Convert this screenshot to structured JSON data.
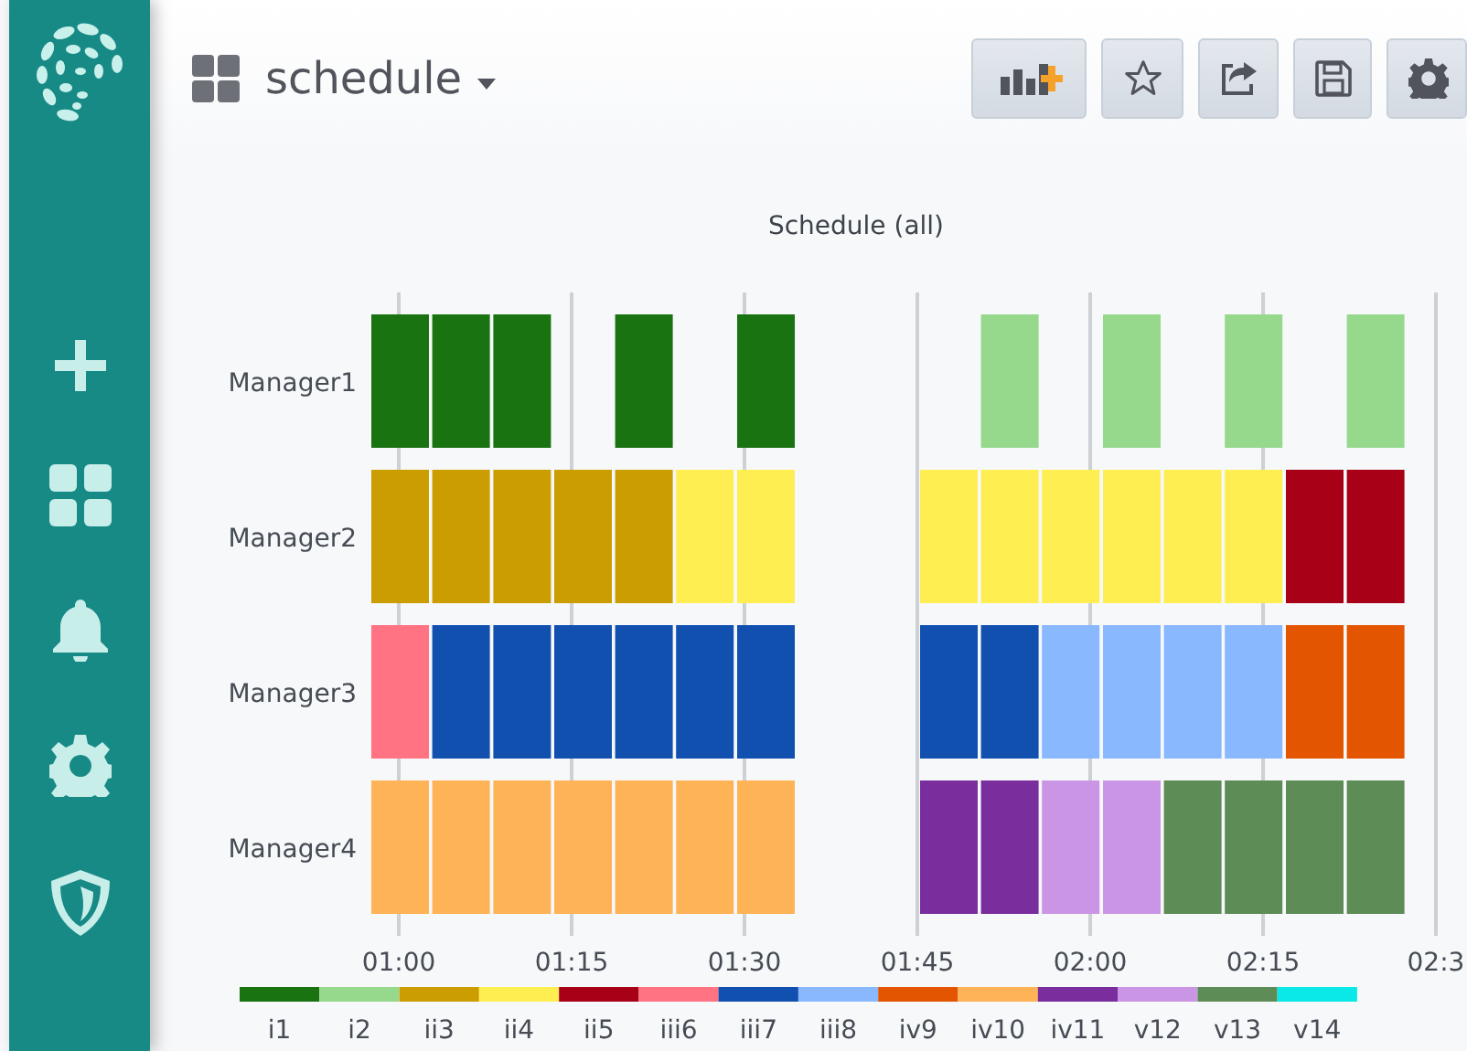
{
  "dashboard": {
    "title": "schedule"
  },
  "panel": {
    "title": "Schedule (all)",
    "x_ticks": [
      "01:00",
      "01:15",
      "01:30",
      "01:45",
      "02:00",
      "02:15",
      "02:3"
    ],
    "rows": [
      {
        "name": "Manager1",
        "cells": [
          {
            "kind": "state",
            "color": "#1a7311"
          },
          {
            "kind": "state",
            "color": "#1a7311"
          },
          {
            "kind": "state",
            "color": "#1a7311"
          },
          {
            "kind": "gap"
          },
          {
            "kind": "state",
            "color": "#1a7311"
          },
          {
            "kind": "gap"
          },
          {
            "kind": "state",
            "color": "#1a7311"
          },
          {
            "kind": "gap"
          },
          {
            "kind": "gap"
          },
          {
            "kind": "gap"
          },
          {
            "kind": "state",
            "color": "#96d98d"
          },
          {
            "kind": "gap"
          },
          {
            "kind": "state",
            "color": "#96d98d"
          },
          {
            "kind": "gap"
          },
          {
            "kind": "state",
            "color": "#96d98d"
          },
          {
            "kind": "gap"
          },
          {
            "kind": "state",
            "color": "#96d98d"
          }
        ]
      },
      {
        "name": "Manager2",
        "cells": [
          {
            "kind": "state",
            "color": "#cc9d00"
          },
          {
            "kind": "state",
            "color": "#cc9d00"
          },
          {
            "kind": "state",
            "color": "#cc9d00"
          },
          {
            "kind": "state",
            "color": "#cc9d00"
          },
          {
            "kind": "state",
            "color": "#cc9d00"
          },
          {
            "kind": "state",
            "color": "#ffee52"
          },
          {
            "kind": "state",
            "color": "#ffee52"
          },
          {
            "kind": "gap"
          },
          {
            "kind": "gap"
          },
          {
            "kind": "state",
            "color": "#ffee52"
          },
          {
            "kind": "state",
            "color": "#ffee52"
          },
          {
            "kind": "state",
            "color": "#ffee52"
          },
          {
            "kind": "state",
            "color": "#ffee52"
          },
          {
            "kind": "state",
            "color": "#ffee52"
          },
          {
            "kind": "state",
            "color": "#ffee52"
          },
          {
            "kind": "state",
            "color": "#a80016"
          },
          {
            "kind": "state",
            "color": "#a80016"
          }
        ]
      },
      {
        "name": "Manager3",
        "cells": [
          {
            "kind": "state",
            "color": "#ff7383"
          },
          {
            "kind": "state",
            "color": "#1250b0"
          },
          {
            "kind": "state",
            "color": "#1250b0"
          },
          {
            "kind": "state",
            "color": "#1250b0"
          },
          {
            "kind": "state",
            "color": "#1250b0"
          },
          {
            "kind": "state",
            "color": "#1250b0"
          },
          {
            "kind": "state",
            "color": "#1250b0"
          },
          {
            "kind": "gap"
          },
          {
            "kind": "gap"
          },
          {
            "kind": "state",
            "color": "#1250b0"
          },
          {
            "kind": "state",
            "color": "#1250b0"
          },
          {
            "kind": "state",
            "color": "#8ab8ff"
          },
          {
            "kind": "state",
            "color": "#8ab8ff"
          },
          {
            "kind": "state",
            "color": "#8ab8ff"
          },
          {
            "kind": "state",
            "color": "#8ab8ff"
          },
          {
            "kind": "state",
            "color": "#e35500"
          },
          {
            "kind": "state",
            "color": "#e35500"
          }
        ]
      },
      {
        "name": "Manager4",
        "cells": [
          {
            "kind": "state",
            "color": "#ffb357"
          },
          {
            "kind": "state",
            "color": "#ffb357"
          },
          {
            "kind": "state",
            "color": "#ffb357"
          },
          {
            "kind": "state",
            "color": "#ffb357"
          },
          {
            "kind": "state",
            "color": "#ffb357"
          },
          {
            "kind": "state",
            "color": "#ffb357"
          },
          {
            "kind": "state",
            "color": "#ffb357"
          },
          {
            "kind": "gap"
          },
          {
            "kind": "gap"
          },
          {
            "kind": "state",
            "color": "#7a2e9e"
          },
          {
            "kind": "state",
            "color": "#7a2e9e"
          },
          {
            "kind": "state",
            "color": "#ca95e5"
          },
          {
            "kind": "state",
            "color": "#ca95e5"
          },
          {
            "kind": "state",
            "color": "#5e8c56"
          },
          {
            "kind": "state",
            "color": "#5e8c56"
          },
          {
            "kind": "state",
            "color": "#5e8c56"
          },
          {
            "kind": "state",
            "color": "#5e8c56"
          }
        ]
      }
    ],
    "legend": [
      {
        "label": "i1",
        "color": "#1a7311"
      },
      {
        "label": "i2",
        "color": "#96d98d"
      },
      {
        "label": "ii3",
        "color": "#cc9d00"
      },
      {
        "label": "ii4",
        "color": "#ffee52"
      },
      {
        "label": "ii5",
        "color": "#a80016"
      },
      {
        "label": "iii6",
        "color": "#ff7383"
      },
      {
        "label": "iii7",
        "color": "#1250b0"
      },
      {
        "label": "iii8",
        "color": "#8ab8ff"
      },
      {
        "label": "iv9",
        "color": "#e35500"
      },
      {
        "label": "iv10",
        "color": "#ffb357"
      },
      {
        "label": "iv11",
        "color": "#7a2e9e"
      },
      {
        "label": "v12",
        "color": "#ca95e5"
      },
      {
        "label": "v13",
        "color": "#5e8c56"
      },
      {
        "label": "v14",
        "color": "#0ae8e8"
      }
    ]
  }
}
